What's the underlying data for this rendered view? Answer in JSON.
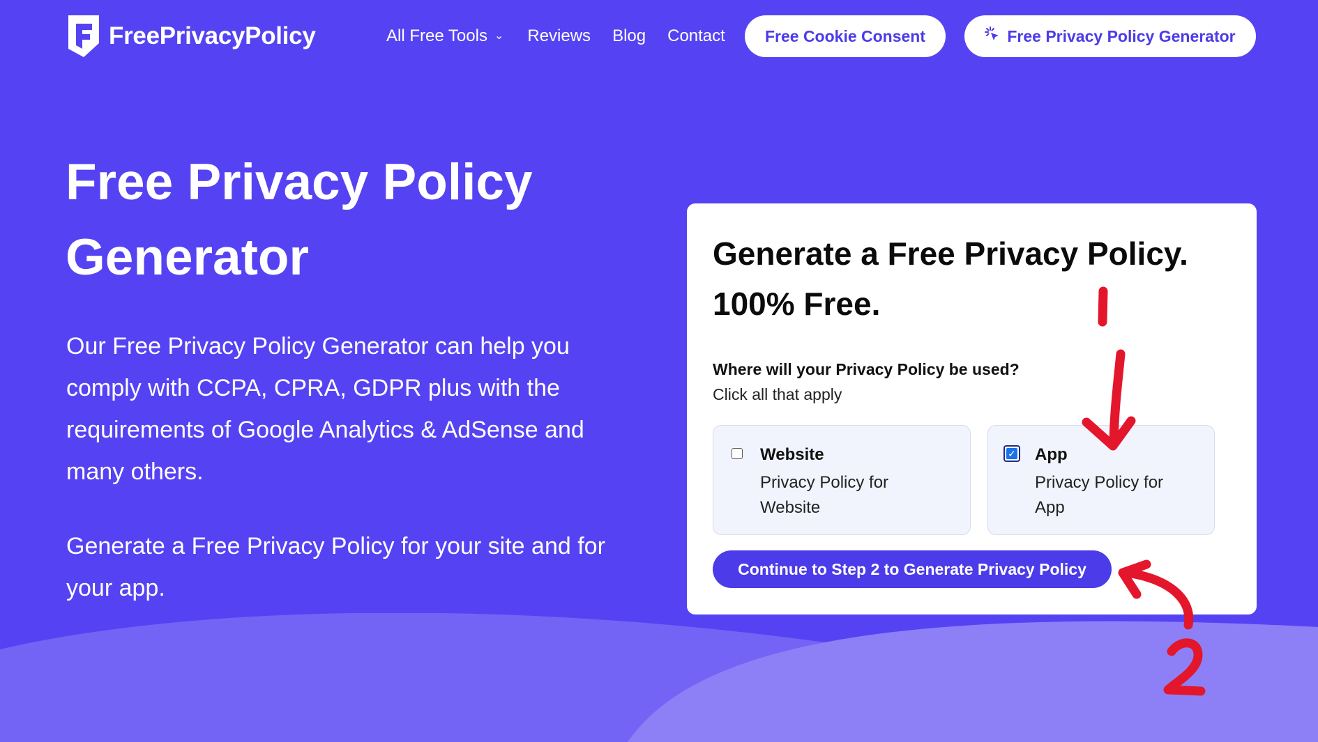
{
  "header": {
    "logo_text": "FreePrivacyPolicy",
    "nav": {
      "tools_label": "All Free Tools",
      "reviews_label": "Reviews",
      "blog_label": "Blog",
      "contact_label": "Contact"
    },
    "cookie_button_label": "Free Cookie Consent",
    "generator_button_label": "Free Privacy Policy Generator"
  },
  "hero": {
    "title": "Free Privacy Policy Generator",
    "paragraph1": "Our Free Privacy Policy Generator can help you comply with CCPA, CPRA, GDPR plus with the requirements of Google Analytics & AdSense and many others.",
    "paragraph2": "Generate a Free Privacy Policy for your site and for your app."
  },
  "card": {
    "title_line1": "Generate a Free Privacy Policy.",
    "title_line2": "100% Free.",
    "question": "Where will your Privacy Policy be used?",
    "subtext": "Click all that apply",
    "options": [
      {
        "label": "Website",
        "description": "Privacy Policy for Website",
        "checked": false
      },
      {
        "label": "App",
        "description": "Privacy Policy for App",
        "checked": true
      }
    ],
    "cta_label": "Continue to Step 2 to Generate Privacy Policy"
  },
  "annotations": {
    "color": "#e4162b",
    "step_labels": [
      "1",
      "2"
    ]
  },
  "colors": {
    "background": "#5543f3",
    "accent": "#4b3be8",
    "card": "#ffffff",
    "checkbox_checked": "#1a73e8"
  }
}
